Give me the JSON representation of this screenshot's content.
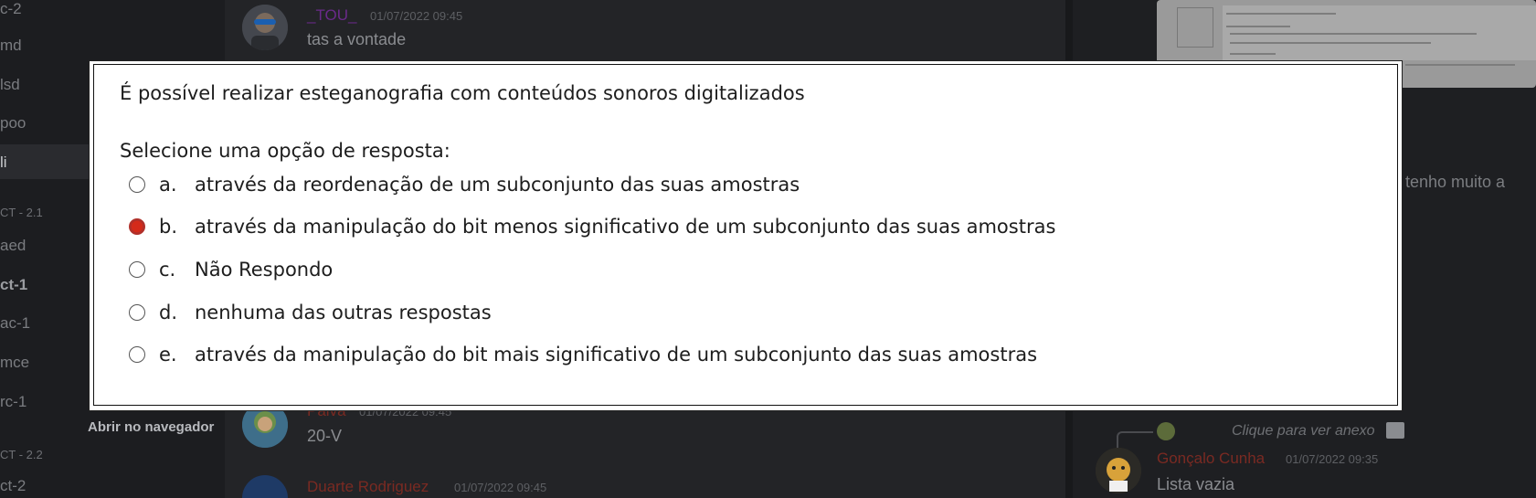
{
  "sidebar": {
    "channels": [
      "c-2",
      "md",
      "lsd",
      "poo",
      "li",
      "aed",
      "ct-1",
      "ac-1",
      "mce",
      "rc-1",
      "ct-2"
    ],
    "categories": [
      "CT - 2.1",
      "CT - 2.2"
    ],
    "open_in_browser": "Abrir no navegador"
  },
  "chat": {
    "messages": [
      {
        "author": "_TOU_",
        "time": "01/07/2022 09:45",
        "text": "tas a vontade",
        "author_color": "#6a2a8a"
      },
      {
        "author": "Paiva",
        "time": "01/07/2022 09:45",
        "text": "20-V",
        "author_color": "#7a2a22"
      },
      {
        "author": "Duarte Rodriguez",
        "time": "01/07/2022 09:45",
        "text": "",
        "author_color": "#7a2a22"
      }
    ]
  },
  "right_panel": {
    "partial_text": "tenho muito a",
    "reply_preview": "Clique para ver anexo",
    "message": {
      "author": "Gonçalo Cunha",
      "time": "01/07/2022 09:35",
      "text": "Lista vazia",
      "author_color": "#7a2a22"
    }
  },
  "quiz": {
    "question": "É possível realizar esteganografia com conteúdos sonoros digitalizados",
    "prompt": "Selecione uma opção de resposta:",
    "options": [
      {
        "letter": "a.",
        "text": "através da reordenação de um subconjunto das suas amostras",
        "selected": false
      },
      {
        "letter": "b.",
        "text": "através da manipulação do bit menos significativo de um subconjunto das suas amostras",
        "selected": true
      },
      {
        "letter": "c.",
        "text": "Não Respondo",
        "selected": false
      },
      {
        "letter": "d.",
        "text": "nenhuma das outras respostas",
        "selected": false
      },
      {
        "letter": "e.",
        "text": "através da manipulação do bit mais significativo de um subconjunto das suas amostras",
        "selected": false
      }
    ]
  },
  "colors": {
    "selected_radio": "#d42a1a",
    "dialog_bg": "#ffffff",
    "app_bg": "#1f1f22"
  }
}
